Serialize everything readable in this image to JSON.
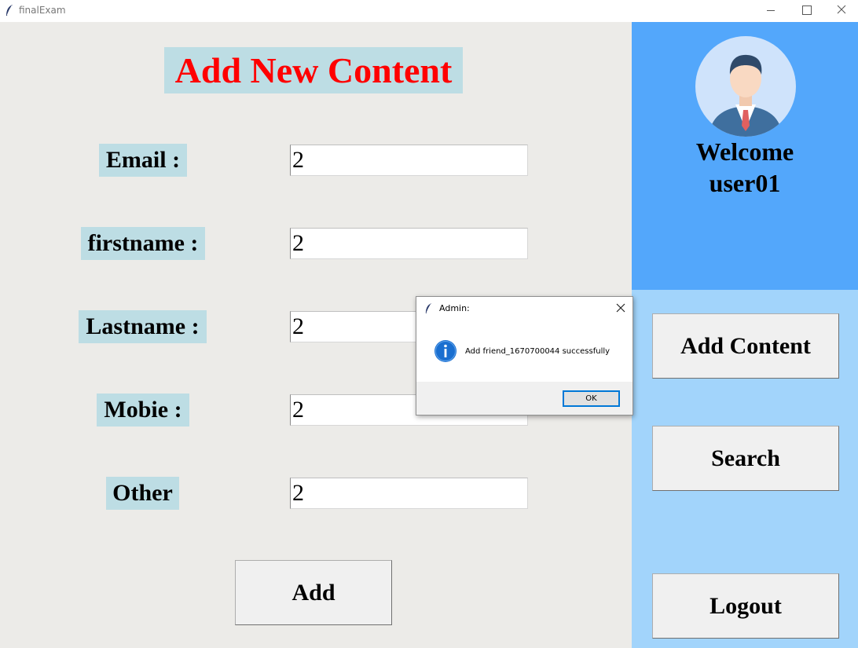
{
  "window": {
    "title": "finalExam"
  },
  "form": {
    "heading": "Add New Content",
    "fields": [
      {
        "label": "Email :",
        "value": "2"
      },
      {
        "label": "firstname :",
        "value": "2"
      },
      {
        "label": "Lastname :",
        "value": "2"
      },
      {
        "label": "Mobie :",
        "value": "2"
      },
      {
        "label": "Other",
        "value": "2"
      }
    ],
    "add_label": "Add"
  },
  "sidebar": {
    "welcome": "Welcome",
    "username": "user01",
    "add_content_label": "Add Content",
    "search_label": "Search",
    "logout_label": "Logout",
    "colors": {
      "top": "#53a7fb",
      "bottom": "#a2d4fb"
    }
  },
  "dialog": {
    "title": "Admin:",
    "message": "Add friend_1670700044 successfully",
    "ok_label": "OK"
  },
  "colors": {
    "heading": "#ff0000",
    "label_bg": "#bddde4",
    "window_bg": "#ecebe8"
  }
}
